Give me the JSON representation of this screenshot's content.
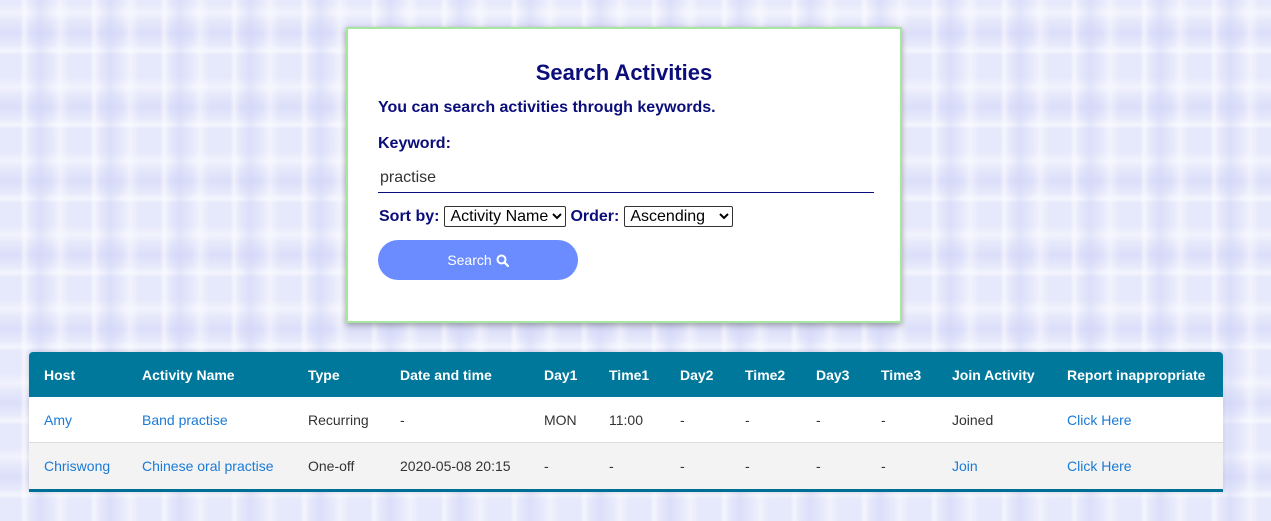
{
  "search": {
    "title": "Search Activities",
    "subtitle": "You can search activities through keywords.",
    "keyword_label": "Keyword:",
    "keyword_value": "practise",
    "sort_by_label": "Sort by:",
    "sort_by_value": "Activity Name",
    "order_label": "Order:",
    "order_value": "Ascending",
    "button_label": "Search"
  },
  "table": {
    "headers": [
      "Host",
      "Activity Name",
      "Type",
      "Date and time",
      "Day1",
      "Time1",
      "Day2",
      "Time2",
      "Day3",
      "Time3",
      "Join Activity",
      "Report inappropriate"
    ],
    "rows": [
      {
        "host": "Amy",
        "activity_name": "Band practise",
        "type": "Recurring",
        "date_time": "-",
        "day1": "MON",
        "time1": "11:00",
        "day2": "-",
        "time2": "-",
        "day3": "-",
        "time3": "-",
        "join": "Joined",
        "report": "Click Here"
      },
      {
        "host": "Chriswong",
        "activity_name": "Chinese oral practise",
        "type": "One-off",
        "date_time": "2020-05-08 20:15",
        "day1": "-",
        "time1": "-",
        "day2": "-",
        "time2": "-",
        "day3": "-",
        "time3": "-",
        "join": "Join",
        "report": "Click Here"
      }
    ]
  },
  "colors": {
    "heading": "#0b0d7a",
    "button": "#6b8cff",
    "table_header": "#00789c",
    "link": "#1a7ad6",
    "card_border": "#a6e6a0"
  },
  "icons": {
    "search_button_icon": "search-icon"
  }
}
